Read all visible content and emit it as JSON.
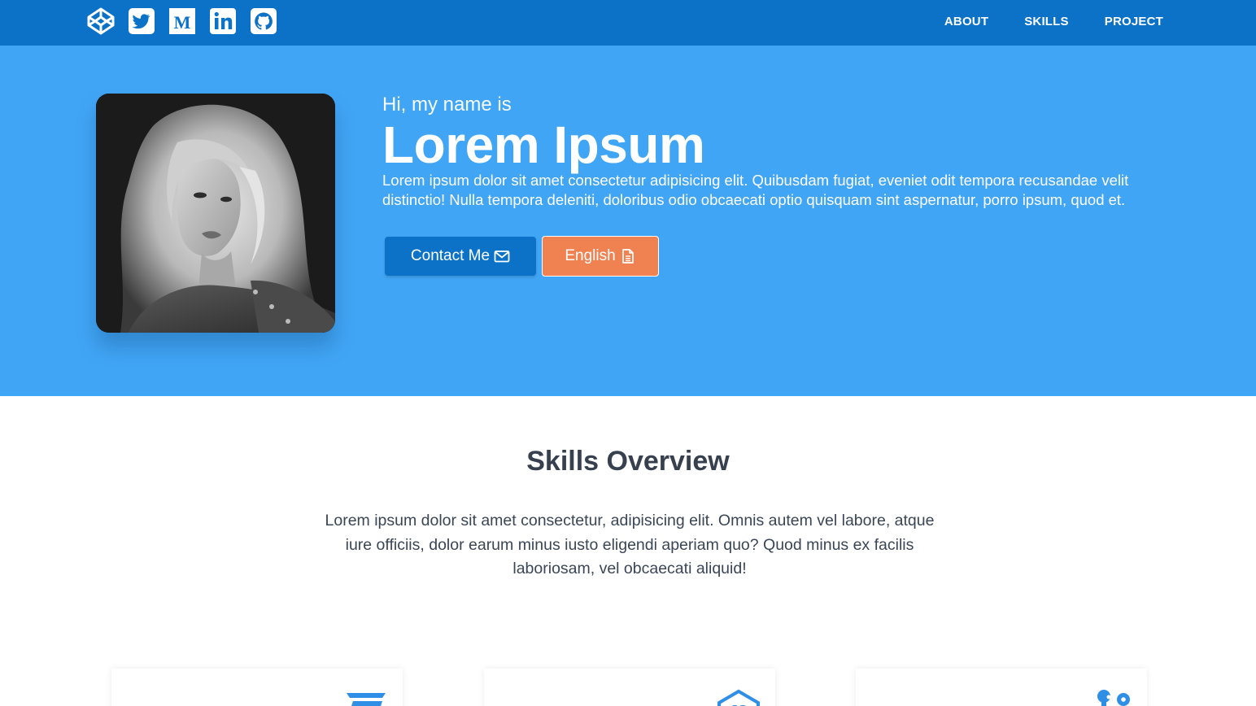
{
  "nav": {
    "social": [
      {
        "icon": "codepen-icon"
      },
      {
        "icon": "twitter-icon"
      },
      {
        "icon": "medium-icon"
      },
      {
        "icon": "linkedin-icon"
      },
      {
        "icon": "github-icon"
      }
    ],
    "links": [
      "ABOUT",
      "SKILLS",
      "PROJECT"
    ]
  },
  "hero": {
    "greeting": "Hi, my name is",
    "name": "Lorem Ipsum",
    "intro": "Lorem ipsum dolor sit amet consectetur adipisicing elit. Quibusdam fugiat, eveniet odit tempora recusandae velit distinctio! Nulla tempora deleniti, doloribus odio obcaecati optio quisquam sint aspernatur, porro ipsum, quod et.",
    "contact_label": "Contact Me",
    "english_label": "English"
  },
  "skills": {
    "title": "Skills Overview",
    "description": "Lorem ipsum dolor sit amet consectetur, adipisicing elit. Omnis autem vel labore, atque iure officiis, dolor earum minus iusto eligendi aperiam quo? Quod minus ex facilis laboriosam, vel obcaecati aliquid!",
    "cards": [
      {
        "icon": "css3-icon"
      },
      {
        "icon": "js-icon"
      },
      {
        "icon": "git-icon"
      }
    ]
  },
  "colors": {
    "navbar": "#0b72c8",
    "hero": "#41a5f5",
    "contact_button": "#0b72c8",
    "english_button": "#f08150",
    "skill_icon": "#2f8fe6"
  }
}
